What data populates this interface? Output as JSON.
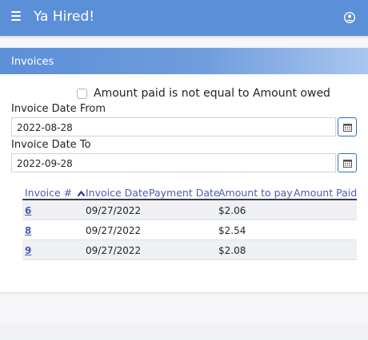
{
  "app": {
    "title": "Ya Hired!"
  },
  "icons": {
    "menu": "hamburger-icon",
    "account": "account-circle-icon",
    "calendar": "calendar-icon",
    "sort": "chevron-up-icon"
  },
  "colors": {
    "header": "#5b8fd8",
    "link": "#4a5cb4"
  },
  "card": {
    "title": "Invoices"
  },
  "filter": {
    "checkbox_label": "Amount paid is not equal to Amount owed",
    "checked": false
  },
  "date_from": {
    "label": "Invoice Date From",
    "value": "2022-08-28"
  },
  "date_to": {
    "label": "Invoice Date To",
    "value": "2022-09-28"
  },
  "table": {
    "columns": [
      "Invoice #",
      "Invoice Date",
      "Payment Date",
      "Amount to pay",
      "Amount Paid"
    ],
    "rows": [
      {
        "invoice": "6",
        "invoice_date": "09/27/2022",
        "payment_date": "",
        "amount_to_pay": "$2.06",
        "amount_paid": ""
      },
      {
        "invoice": "8",
        "invoice_date": "09/27/2022",
        "payment_date": "",
        "amount_to_pay": "$2.54",
        "amount_paid": ""
      },
      {
        "invoice": "9",
        "invoice_date": "09/27/2022",
        "payment_date": "",
        "amount_to_pay": "$2.08",
        "amount_paid": ""
      }
    ]
  }
}
